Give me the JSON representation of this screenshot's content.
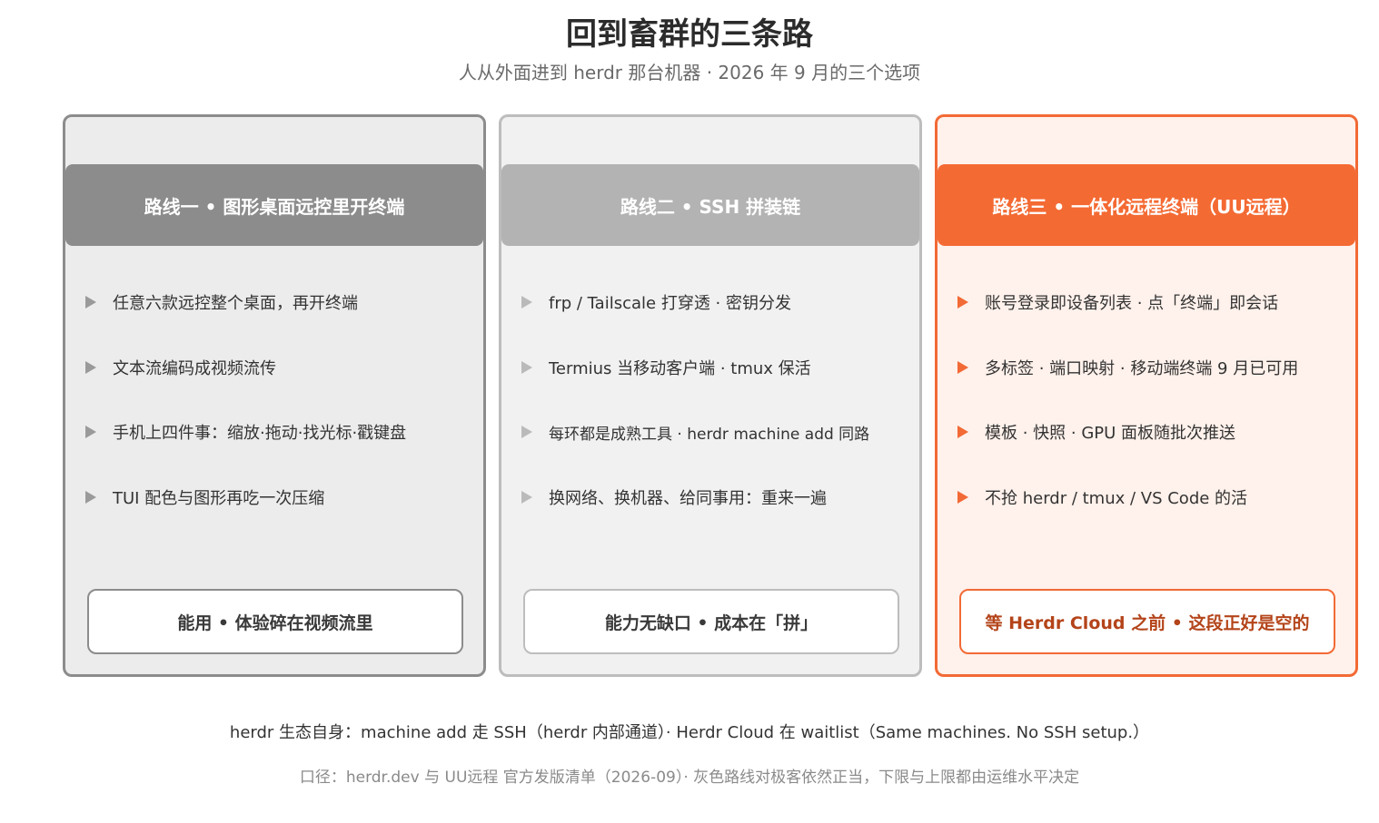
{
  "title": "回到畜群的三条路",
  "subtitle": "人从外面进到 herdr 那台机器 · 2026 年 9 月的三个选项",
  "cards": [
    {
      "heading": "路线一 • 图形桌面远控里开终端",
      "items": [
        "任意六款远控整个桌面，再开终端",
        "文本流编码成视频流传",
        "手机上四件事：缩放·拖动·找光标·戳键盘",
        "TUI 配色与图形再吃一次压缩"
      ],
      "verdict": "能用 • 体验碎在视频流里"
    },
    {
      "heading": "路线二 • SSH 拼装链",
      "items": [
        "frp / Tailscale 打穿透 · 密钥分发",
        "Termius 当移动客户端 · tmux 保活",
        "每环都是成熟工具 · herdr machine add 同路",
        "换网络、换机器、给同事用：重来一遍"
      ],
      "verdict": "能力无缺口 • 成本在「拼」"
    },
    {
      "heading": "路线三 • 一体化远程终端（UU远程）",
      "items": [
        "账号登录即设备列表 · 点「终端」即会话",
        "多标签 · 端口映射 · 移动端终端 9 月已可用",
        "模板 · 快照 · GPU 面板随批次推送",
        "不抢 herdr / tmux / VS Code 的活"
      ],
      "verdict": "等 Herdr Cloud 之前 • 这段正好是空的"
    }
  ],
  "footer_note": "herdr 生态自身：machine add 走 SSH（herdr 内部通道）· Herdr Cloud 在 waitlist（Same machines. No SSH setup.）",
  "source_note": "口径：herdr.dev 与 UU远程 官方发版清单（2026-09）· 灰色路线对极客依然正当，下限与上限都由运维水平决定",
  "colors": {
    "route1": "#8c8c8c",
    "route2": "#b3b3b3",
    "route3": "#f46a33",
    "route3_text": "#b4441a"
  }
}
